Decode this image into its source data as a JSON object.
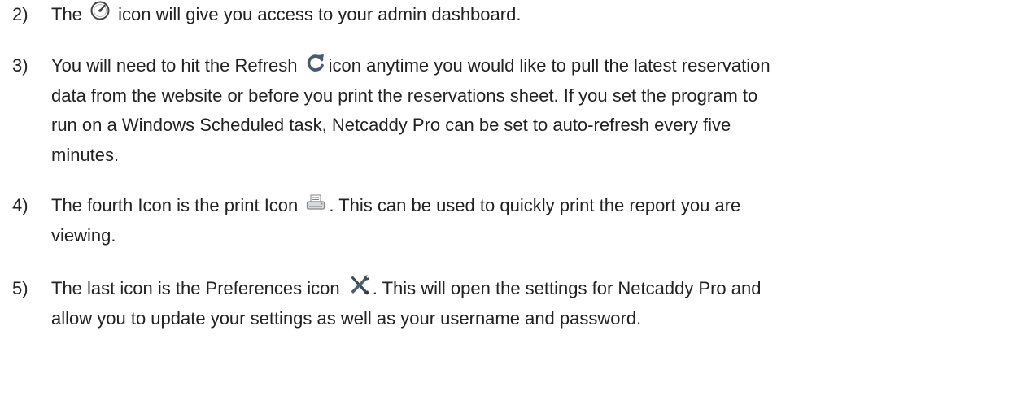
{
  "items": [
    {
      "number": "2)",
      "lines": [
        {
          "before": "The",
          "icon": "dashboard-gauge-icon",
          "after": "icon will give you access to your admin dashboard."
        }
      ]
    },
    {
      "number": "3)",
      "lines": [
        {
          "before": "You will need to hit the Refresh",
          "icon": "refresh-icon",
          "after": "icon anytime you would like to pull the latest reservation"
        },
        {
          "text": "data from the website or before you print the reservations sheet. If you set the program to"
        },
        {
          "text": "run on a Windows Scheduled task, Netcaddy Pro can be set to auto-refresh every five"
        },
        {
          "text": "minutes."
        }
      ]
    },
    {
      "number": "4)",
      "lines": [
        {
          "before": "The fourth Icon is the print Icon",
          "icon": "printer-icon",
          "after": ". This can be used to quickly print the report you are"
        },
        {
          "text": "viewing."
        }
      ]
    },
    {
      "number": "5)",
      "lines": [
        {
          "before": "The last icon is the Preferences icon",
          "icon": "preferences-tools-icon",
          "after": ". This will open the settings for Netcaddy Pro and"
        },
        {
          "text": "allow you to update your settings as well as your username and password."
        }
      ]
    }
  ]
}
